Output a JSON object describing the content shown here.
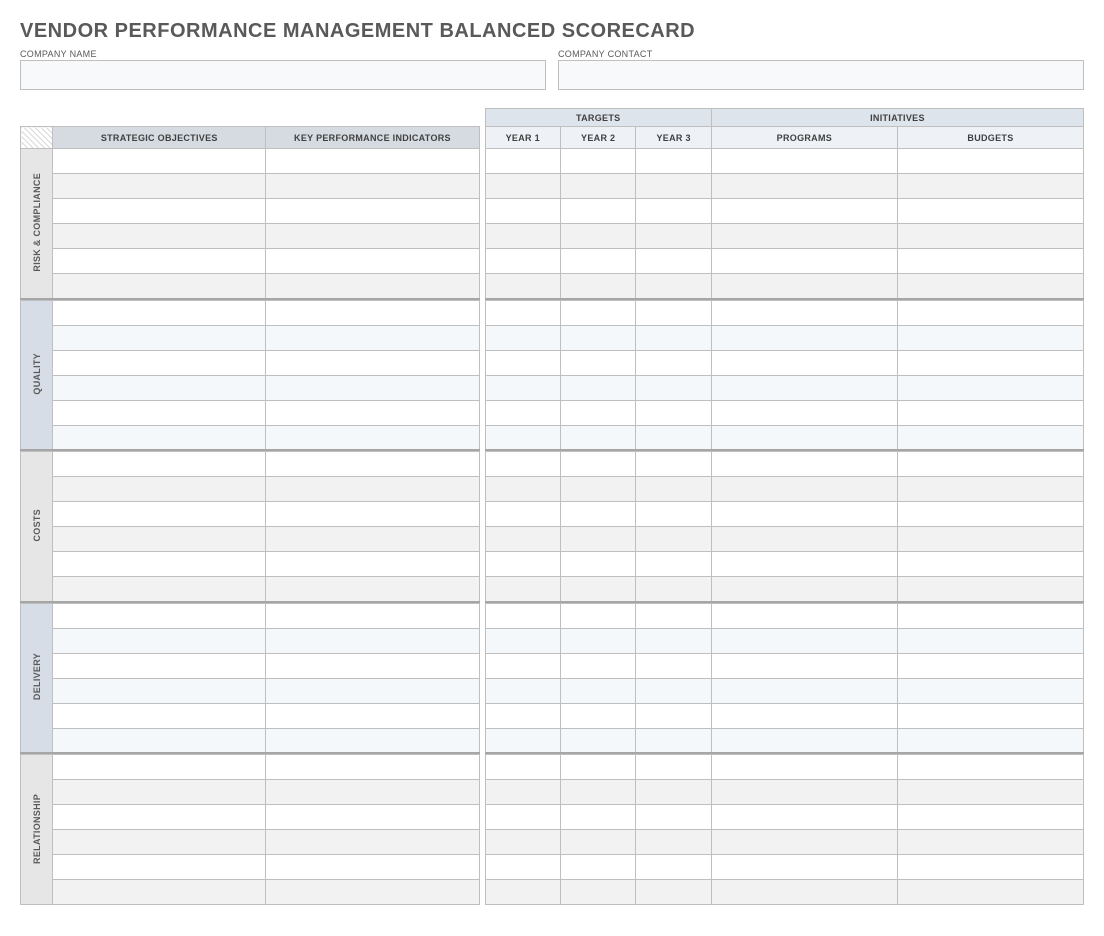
{
  "title": "VENDOR PERFORMANCE MANAGEMENT BALANCED SCORECARD",
  "company": {
    "name_label": "COMPANY NAME",
    "name_value": "",
    "contact_label": "COMPANY CONTACT",
    "contact_value": ""
  },
  "headers": {
    "targets": "TARGETS",
    "initiatives": "INITIATIVES",
    "strategic_objectives": "STRATEGIC OBJECTIVES",
    "kpi": "KEY PERFORMANCE INDICATORS",
    "year1": "YEAR 1",
    "year2": "YEAR 2",
    "year3": "YEAR 3",
    "programs": "PROGRAMS",
    "budgets": "BUDGETS"
  },
  "categories": [
    {
      "id": "risk",
      "label": "RISK & COMPLIANCE",
      "tone": "grey",
      "rows": 6
    },
    {
      "id": "quality",
      "label": "QUALITY",
      "tone": "blue",
      "rows": 6
    },
    {
      "id": "costs",
      "label": "COSTS",
      "tone": "grey",
      "rows": 6
    },
    {
      "id": "delivery",
      "label": "DELIVERY",
      "tone": "blue",
      "rows": 6
    },
    {
      "id": "relationship",
      "label": "RELATIONSHIP",
      "tone": "grey",
      "rows": 6
    }
  ]
}
